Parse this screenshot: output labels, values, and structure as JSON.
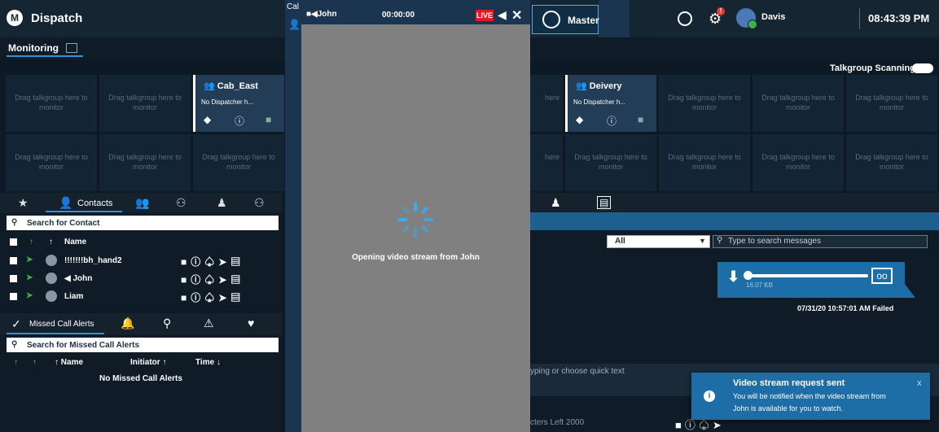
{
  "header": {
    "app_title": "Dispatch",
    "logo_letter": "M",
    "master_label": "Master",
    "user_name": "Davis",
    "alert_count": "!",
    "clock": "08:43:39 PM"
  },
  "video_call": {
    "tab_prefix": "Cal",
    "caller_name": "John",
    "timer": "00:00:00",
    "live_label": "LIVE",
    "status_message": "Opening video stream from John"
  },
  "monitoring": {
    "title": "Monitoring",
    "talkgroup_scanning_label": "Talkgroup Scanning",
    "empty_tile_text": "Drag talkgroup here to monitor",
    "active_tiles": [
      {
        "name": "Cab_East",
        "status": "No Dispatcher h..."
      },
      {
        "name": "Deivery",
        "status": "No Dispatcher h..."
      }
    ],
    "partial_tile_text_1": "here",
    "partial_tile_text_2": "r"
  },
  "contacts": {
    "tab_label": "Contacts",
    "search_placeholder": "Search for Contact",
    "name_header": "Name",
    "rows": [
      {
        "name": "!!!!!!!bh_hand2"
      },
      {
        "name": "John"
      },
      {
        "name": "Liam"
      }
    ]
  },
  "missed_calls": {
    "tab_label": "Missed Call Alerts",
    "search_placeholder": "Search for Missed Call Alerts",
    "col_name": "Name",
    "col_initiator": "Initiator",
    "col_time": "Time",
    "empty_text": "No Missed Call Alerts"
  },
  "chat": {
    "filter_value": "All",
    "search_placeholder": "Type to search messages",
    "attachment_size": "16.07 KB",
    "message_status": "07/31/20 10:57:01 AM Failed",
    "compose_placeholder": "yping or choose quick text",
    "chars_left": "cters Left 2000"
  },
  "toast": {
    "title": "Video stream request sent",
    "body_line1": "You will be notified when the video stream from",
    "body_line2": "John is available for you to watch.",
    "close": "x"
  },
  "colors": {
    "accent": "#1d6ea6",
    "live": "#e2191e",
    "online": "#3db24a"
  }
}
